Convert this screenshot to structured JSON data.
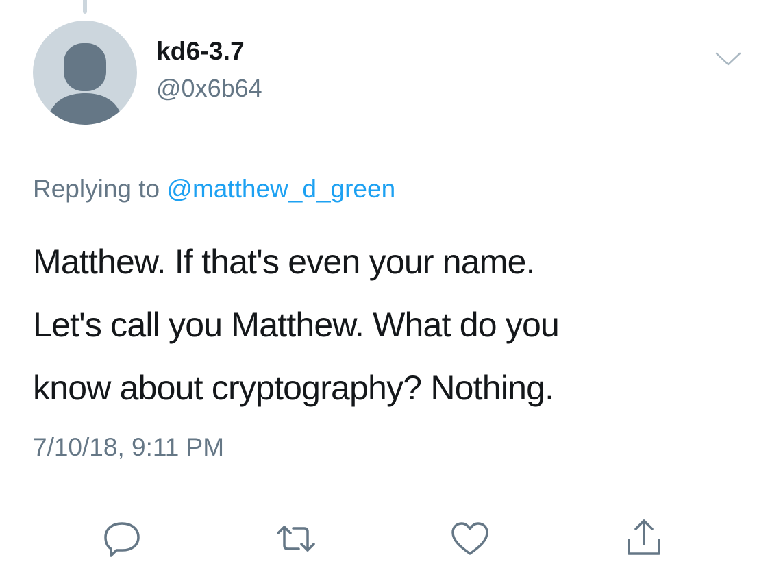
{
  "user": {
    "display_name": "kd6-3.7",
    "handle": "@0x6b64",
    "avatar_icon": "default-profile-silhouette-icon"
  },
  "reply": {
    "prefix": "Replying to",
    "mention": "@matthew_d_green"
  },
  "tweet": {
    "text_lines": [
      "Matthew. If that's even your name.",
      "Let's call you Matthew. What do you",
      "know about cryptography? Nothing."
    ],
    "timestamp": "7/10/18, 9:11 PM"
  },
  "actions": {
    "reply_icon": "reply-icon",
    "retweet_icon": "retweet-icon",
    "like_icon": "heart-icon",
    "share_icon": "share-icon",
    "caret_icon": "chevron-down-icon"
  },
  "colors": {
    "text": "#14171a",
    "secondary": "#657786",
    "link": "#1da1f2",
    "avatar_bg": "#ccd6dd",
    "avatar_fg": "#657786",
    "divider": "#e1e8ed"
  }
}
